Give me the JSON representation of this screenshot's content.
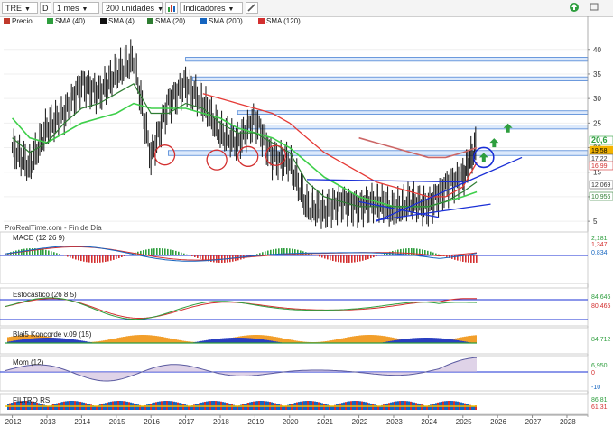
{
  "toolbar": {
    "symbol": "TRE",
    "period_code": "D",
    "timeframe": "1 mes",
    "units": "200 unidades",
    "indicators_label": "Indicadores"
  },
  "legend": [
    {
      "label": "Precio",
      "color": "#c0392b"
    },
    {
      "label": "SMA (40)",
      "color": "#2e9e3e"
    },
    {
      "label": "SMA (4)",
      "color": "#111111"
    },
    {
      "label": "SMA (20)",
      "color": "#2e7d32"
    },
    {
      "label": "SMA (200)",
      "color": "#1565c0"
    },
    {
      "label": "SMA (120)",
      "color": "#d32f2f"
    }
  ],
  "price_axis": {
    "ticks": [
      "40",
      "35",
      "30",
      "25",
      "20",
      "15",
      "10",
      "5"
    ]
  },
  "price_tags": [
    {
      "text": "20,6",
      "color": "#2e9e3e",
      "bg": "#ffffff",
      "fg": "#2e9e3e"
    },
    {
      "text": "19,58",
      "color": "#f5b400",
      "bg": "#f5b400",
      "fg": "#000000"
    },
    {
      "text": "17,22",
      "color": "#555555",
      "bg": "#ffffff",
      "fg": "#333333"
    },
    {
      "text": "16,99",
      "color": "#d32f2f",
      "bg": "#ffffff",
      "fg": "#d32f2f"
    },
    {
      "text": "12,069",
      "color": "#555555",
      "bg": "#ffffff",
      "fg": "#333333"
    },
    {
      "text": "10,956",
      "color": "#2e7d32",
      "bg": "#ffffff",
      "fg": "#2e7d32"
    }
  ],
  "watermark": "ProRealTime.com - Fin de Día",
  "panels": {
    "macd": {
      "title": "MACD (12 26 9)",
      "values": [
        "2,181",
        "1,347",
        "0,834"
      ]
    },
    "stoch": {
      "title": "Estocástico (26 8 5)",
      "values": [
        "84,646",
        "80,465"
      ]
    },
    "koncorde": {
      "title": "Blai5 Koncorde v.09 (15)",
      "values": [
        "84,712"
      ]
    },
    "mom": {
      "title": "Mom (12)",
      "values": [
        "6,950",
        "0",
        "-10"
      ]
    },
    "rsi": {
      "title": "FILTRO RSI",
      "values": [
        "86,81",
        "61,31"
      ]
    }
  },
  "x_axis": {
    "years": [
      "2012",
      "2013",
      "2014",
      "2015",
      "2016",
      "2017",
      "2018",
      "2019",
      "2020",
      "2021",
      "2022",
      "2023",
      "2024",
      "2025",
      "2026",
      "2027",
      "2028"
    ]
  },
  "chart_data": {
    "type": "line",
    "title": "TRE",
    "xlabel": "",
    "ylabel": "",
    "ylim": [
      3,
      44
    ],
    "x": [
      2012.0,
      2012.5,
      2013.0,
      2013.5,
      2014.0,
      2014.5,
      2015.0,
      2015.5,
      2016.0,
      2016.5,
      2017.0,
      2017.5,
      2018.0,
      2018.5,
      2019.0,
      2019.5,
      2020.0,
      2020.5,
      2021.0,
      2021.5,
      2022.0,
      2022.5,
      2023.0,
      2023.5,
      2024.0,
      2024.5,
      2025.0,
      2025.4
    ],
    "series": [
      {
        "name": "Precio",
        "values": [
          20,
          16,
          24,
          27,
          33,
          31,
          35,
          38,
          18,
          29,
          33,
          29,
          23,
          21,
          26,
          18,
          17,
          8,
          7,
          9,
          8,
          9,
          7,
          9,
          8,
          12,
          14,
          20.6
        ]
      },
      {
        "name": "SMA (40)",
        "values": [
          26,
          22,
          21,
          23,
          25,
          26,
          27,
          29,
          28,
          28,
          28,
          27,
          26,
          24,
          23,
          22,
          20,
          17,
          14,
          12,
          10,
          9,
          8,
          8,
          8,
          9,
          10,
          11
        ]
      },
      {
        "name": "SMA (20)",
        "values": [
          22,
          19,
          21,
          25,
          28,
          29,
          31,
          33,
          27,
          27,
          29,
          28,
          25,
          23,
          23,
          21,
          19,
          13,
          10,
          9,
          8,
          8,
          8,
          8,
          8,
          9,
          11,
          13
        ]
      },
      {
        "name": "SMA (120)",
        "values": [
          null,
          null,
          null,
          null,
          null,
          null,
          null,
          null,
          null,
          null,
          null,
          31,
          30,
          29,
          28,
          27,
          25,
          22,
          19,
          17,
          15,
          13,
          12,
          11,
          10,
          10,
          12,
          17
        ]
      },
      {
        "name": "SMA (200)",
        "values": [
          null,
          null,
          null,
          null,
          null,
          null,
          null,
          null,
          null,
          null,
          null,
          null,
          null,
          null,
          null,
          null,
          null,
          null,
          null,
          null,
          22,
          21,
          20,
          19,
          18,
          18,
          19,
          20
        ]
      }
    ],
    "zones": [
      {
        "from": 37.6,
        "to": 38.4,
        "start": 2017.0
      },
      {
        "from": 33.6,
        "to": 34.4,
        "start": 2017.2
      },
      {
        "from": 26.8,
        "to": 27.5,
        "start": 2018.5
      },
      {
        "from": 23.8,
        "to": 24.6,
        "start": 2018.3
      },
      {
        "from": 18.4,
        "to": 19.4,
        "start": 2016.5
      }
    ],
    "circles": [
      {
        "x": 2016.4,
        "y": 18.5
      },
      {
        "x": 2017.9,
        "y": 17.5
      },
      {
        "x": 2018.8,
        "y": 18.2
      },
      {
        "x": 2019.6,
        "y": 18.4
      }
    ],
    "highlight_circle": {
      "x": 2025.6,
      "y": 18.0
    },
    "arrows": [
      {
        "x": 2026.3,
        "y": 24.0
      },
      {
        "x": 2025.9,
        "y": 21.0
      },
      {
        "x": 2025.6,
        "y": 18.0
      }
    ],
    "trendlines": [
      {
        "x1": 2020.5,
        "y1": 13.5,
        "x2": 2025.0,
        "y2": 13.0
      },
      {
        "x1": 2022.5,
        "y1": 5.0,
        "x2": 2026.7,
        "y2": 18.0
      },
      {
        "x1": 2022.0,
        "y1": 9.0,
        "x2": 2024.3,
        "y2": 5.8
      },
      {
        "x1": 2022.5,
        "y1": 5.2,
        "x2": 2025.8,
        "y2": 8.5
      }
    ]
  }
}
